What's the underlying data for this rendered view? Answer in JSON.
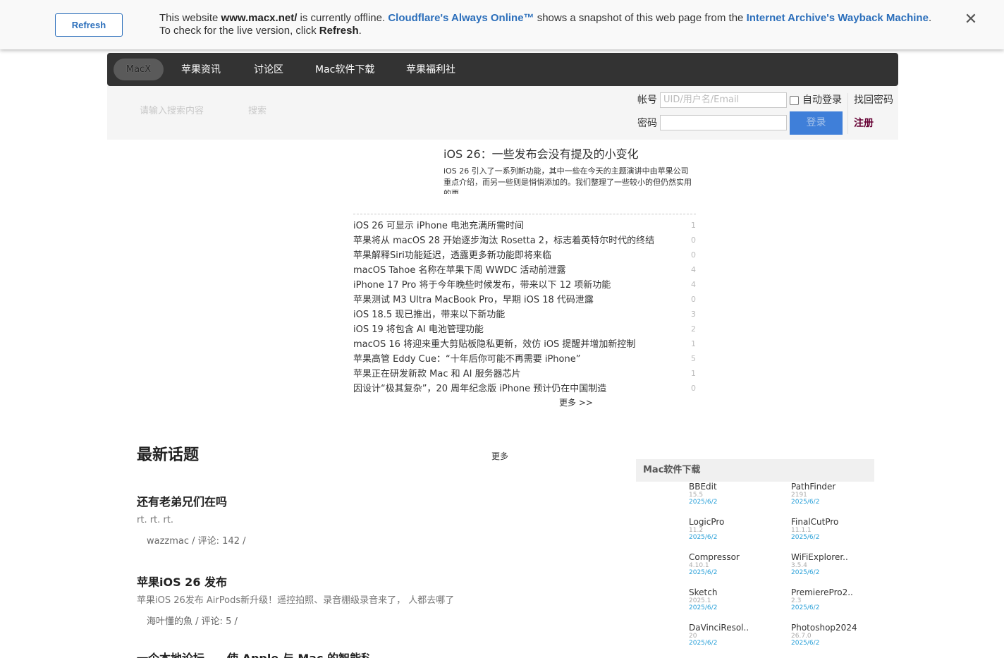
{
  "banner": {
    "refresh_label": "Refresh",
    "msg_prefix": "This website ",
    "site": "www.macx.net/",
    "msg_mid1": " is currently offline. ",
    "cf_link": "Cloudflare's Always Online™",
    "msg_mid2": " shows a snapshot of this web page from the ",
    "archive_link": "Internet Archive's Wayback Machine",
    "msg_end": ".",
    "line2_prefix": "To check for the live version, click ",
    "line2_refresh": "Refresh",
    "line2_end": ".",
    "close_glyph": "✕"
  },
  "nav": {
    "logo": "MacX",
    "items": [
      "苹果资讯",
      "讨论区",
      "Mac软件下载",
      "苹果福利社"
    ]
  },
  "search": {
    "placeholder": "请输入搜索内容",
    "button": "搜索"
  },
  "login": {
    "account_label": "帐号",
    "account_placeholder": "UID/用户名/Email",
    "auto_login": "自动登录",
    "forgot": "找回密码",
    "password_label": "密码",
    "login_button": "登录",
    "register": "注册"
  },
  "featured": {
    "title": "iOS 26：一些发布会没有提及的小变化",
    "summary": "iOS 26 引入了一系列新功能，其中一些在今天的主题演讲中由苹果公司重点介绍，而另一些则是悄悄添加的。我们整理了一些较小的但仍然实用的更"
  },
  "news": [
    {
      "title": "iOS 26 可显示 iPhone 电池充满所需时间",
      "count": "1"
    },
    {
      "title": "苹果将从 macOS 28 开始逐步淘汰 Rosetta 2，标志着英特尔时代的终结",
      "count": "0"
    },
    {
      "title": "苹果解释Siri功能延迟，透露更多新功能即将来临",
      "count": "0"
    },
    {
      "title": "macOS Tahoe 名称在苹果下周 WWDC 活动前泄露",
      "count": "4"
    },
    {
      "title": "iPhone 17 Pro 将于今年晚些时候发布，带来以下 12 项新功能",
      "count": "4"
    },
    {
      "title": "苹果测试 M3 Ultra MacBook Pro，早期 iOS 18 代码泄露",
      "count": "0"
    },
    {
      "title": "iOS 18.5 现已推出，带来以下新功能",
      "count": "3"
    },
    {
      "title": "iOS 19 将包含 AI 电池管理功能",
      "count": "2"
    },
    {
      "title": "macOS 16 将迎来重大剪贴板隐私更新，效仿 iOS 提醒并增加新控制",
      "count": "1"
    },
    {
      "title": "苹果高管 Eddy Cue：“十年后你可能不再需要 iPhone”",
      "count": "5"
    },
    {
      "title": "苹果正在研发新款 Mac 和 AI 服务器芯片",
      "count": "1"
    },
    {
      "title": "因设计“极其复杂”，20 周年纪念版 iPhone 预计仍在中国制造",
      "count": "0"
    }
  ],
  "news_more": "更多 >>",
  "topics": {
    "title": "最新话题",
    "more": "更多",
    "items": [
      {
        "title": "还有老弟兄们在吗",
        "excerpt": "rt. rt. rt.",
        "meta": "wazzmac / 评论: 142 /"
      },
      {
        "title": "苹果iOS 26 发布",
        "excerpt": "苹果iOS 26发布 AirPods新升级！遥控拍照、录音棚级录音来了， 人都去哪了",
        "meta": "海叶懂的魚 / 评论: 5 /"
      }
    ],
    "partial_title": "一个本地论坛——使 Apple 与 Mac 的智能科技"
  },
  "software": {
    "title": "Mac软件下载",
    "items": [
      {
        "name": "BBEdit",
        "version": "15.5",
        "date": "2025/6/2"
      },
      {
        "name": "PathFinder",
        "version": "2191",
        "date": "2025/6/2"
      },
      {
        "name": "LogicPro",
        "version": "11.2",
        "date": "2025/6/2"
      },
      {
        "name": "FinalCutPro",
        "version": "11.1.1",
        "date": "2025/6/2"
      },
      {
        "name": "Compressor",
        "version": "4.10.1",
        "date": "2025/6/2"
      },
      {
        "name": "WiFiExplorer..",
        "version": "3.5.4",
        "date": "2025/6/2"
      },
      {
        "name": "Sketch",
        "version": "2025.1",
        "date": "2025/6/2"
      },
      {
        "name": "PremierePro2..",
        "version": "2.3",
        "date": "2025/6/2"
      },
      {
        "name": "DaVinciResol..",
        "version": "20",
        "date": "2025/6/2"
      },
      {
        "name": "Photoshop2024",
        "version": "26.7.0",
        "date": "2025/6/2"
      }
    ]
  }
}
